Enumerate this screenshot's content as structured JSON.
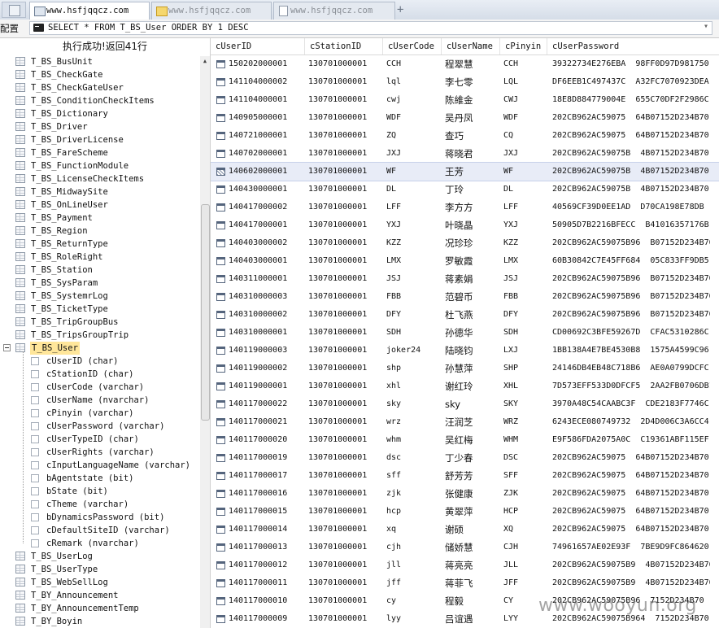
{
  "tabs": [
    {
      "label": "www.hsfjqqcz.com",
      "icon": "window-icon",
      "active": true
    },
    {
      "label": "www.hsfjqqcz.com",
      "icon": "folder-icon",
      "active": false
    },
    {
      "label": "www.hsfjqqcz.com",
      "icon": "page-icon",
      "active": false
    }
  ],
  "new_tab_label": "+",
  "query_bar": {
    "config_label": "配置",
    "sql": "SELECT * FROM T_BS_User ORDER BY 1 DESC"
  },
  "status_text": "执行成功!返回41行",
  "tree": {
    "tables_top": [
      "T_BS_BusUnit",
      "T_BS_CheckGate",
      "T_BS_CheckGateUser",
      "T_BS_ConditionCheckItems",
      "T_BS_Dictionary",
      "T_BS_Driver",
      "T_BS_DriverLicense",
      "T_BS_FareScheme",
      "T_BS_FunctionModule",
      "T_BS_LicenseCheckItems",
      "T_BS_MidwaySite",
      "T_BS_OnLineUser",
      "T_BS_Payment",
      "T_BS_Region",
      "T_BS_ReturnType",
      "T_BS_RoleRight",
      "T_BS_Station",
      "T_BS_SysParam",
      "T_BS_SystemrLog",
      "T_BS_TicketType",
      "T_BS_TripGroupBus",
      "T_BS_TripsGroupTrip"
    ],
    "selected_table": "T_BS_User",
    "columns": [
      "cUserID (char)",
      "cStationID (char)",
      "cUserCode (varchar)",
      "cUserName (nvarchar)",
      "cPinyin (varchar)",
      "cUserPassword (varchar)",
      "cUserTypeID (char)",
      "cUserRights (varchar)",
      "cInputLanguageName (varchar)",
      "bAgentstate (bit)",
      "bState (bit)",
      "cTheme (varchar)",
      "bDynamicsPassword (bit)",
      "cDefaultSiteID (varchar)",
      "cRemark (nvarchar)"
    ],
    "tables_bottom": [
      "T_BS_UserLog",
      "T_BS_UserType",
      "T_BS_WebSellLog",
      "T_BY_Announcement",
      "T_BY_AnnouncementTemp",
      "T_BY_Boyin"
    ]
  },
  "grid": {
    "headers": [
      "cUserID",
      "cStationID",
      "cUserCode",
      "cUserName",
      "cPinyin",
      "cUserPassword"
    ],
    "selected_row": 6,
    "rows": [
      [
        "150202000001",
        "130701000001",
        "CCH",
        "程翠慧",
        "CCH",
        "39322734E276EBA  98FF0D97D981750"
      ],
      [
        "141104000002",
        "130701000001",
        "lql",
        "李七零",
        "LQL",
        "DF6EEB1C497437C  A32FC7070923DEA"
      ],
      [
        "141104000001",
        "130701000001",
        "cwj",
        "陈維金",
        "CWJ",
        "18E8D884779004E  655C70DF2F2986C"
      ],
      [
        "140905000001",
        "130701000001",
        "WDF",
        "吴丹凤",
        "WDF",
        "202CB962AC59075  64B07152D234B70"
      ],
      [
        "140721000001",
        "130701000001",
        "ZQ",
        "查巧",
        "CQ",
        "202CB962AC59075  64B07152D234B70"
      ],
      [
        "140702000001",
        "130701000001",
        "JXJ",
        "蒋晓君",
        "JXJ",
        "202CB962AC59075B  4B07152D234B70"
      ],
      [
        "140602000001",
        "130701000001",
        "WF",
        "王芳",
        "WF",
        "202CB962AC59075B  4B07152D234B70"
      ],
      [
        "140430000001",
        "130701000001",
        "DL",
        "丁玲",
        "DL",
        "202CB962AC59075B  4B07152D234B70"
      ],
      [
        "140417000002",
        "130701000001",
        "LFF",
        "李方方",
        "LFF",
        "40569CF39D0EE1AD  D70CA198E78DB"
      ],
      [
        "140417000001",
        "130701000001",
        "YXJ",
        "叶晓晶",
        "YXJ",
        "50905D7B2216BFECC  B41016357176B"
      ],
      [
        "140403000002",
        "130701000001",
        "KZZ",
        "况珍珍",
        "KZZ",
        "202CB962AC59075B96  B07152D234B70"
      ],
      [
        "140403000001",
        "130701000001",
        "LMX",
        "罗敏霞",
        "LMX",
        "60B30842C7E45FF684  05C833FF9DB5"
      ],
      [
        "140311000001",
        "130701000001",
        "JSJ",
        "蒋素娟",
        "JSJ",
        "202CB962AC59075B96  B07152D234B70"
      ],
      [
        "140310000003",
        "130701000001",
        "FBB",
        "范碧币",
        "FBB",
        "202CB962AC59075B96  B07152D234B70"
      ],
      [
        "140310000002",
        "130701000001",
        "DFY",
        "杜飞燕",
        "DFY",
        "202CB962AC59075B96  B07152D234B70"
      ],
      [
        "140310000001",
        "130701000001",
        "SDH",
        "孙德华",
        "SDH",
        "CD00692C3BFE59267D  CFAC5310286C"
      ],
      [
        "140119000003",
        "130701000001",
        "joker24",
        "陆晓钧",
        "LXJ",
        "1BB138A4E7BE4530B8  1575A4599C96"
      ],
      [
        "140119000002",
        "130701000001",
        "shp",
        "孙慧萍",
        "SHP",
        "24146DB4EB48C718B6  AE0A0799DCFC"
      ],
      [
        "140119000001",
        "130701000001",
        "xhl",
        "谢红玲",
        "XHL",
        "7D573EFF533D0DFCF5  2AA2FB0706DB1"
      ],
      [
        "140117000022",
        "130701000001",
        "sky",
        "sky",
        "SKY",
        "3970A48C54CAABC3F  CDE2183F7746C"
      ],
      [
        "140117000021",
        "130701000001",
        "wrz",
        "汪润芝",
        "WRZ",
        "6243ECE080749732  2D4D006C3A6CC4"
      ],
      [
        "140117000020",
        "130701000001",
        "whm",
        "吴红梅",
        "WHM",
        "E9F586FDA2075A0C  C19361ABF115EF"
      ],
      [
        "140117000019",
        "130701000001",
        "dsc",
        "丁少春",
        "DSC",
        "202CB962AC59075  64B07152D234B70"
      ],
      [
        "140117000017",
        "130701000001",
        "sff",
        "舒芳芳",
        "SFF",
        "202CB962AC59075  64B07152D234B70"
      ],
      [
        "140117000016",
        "130701000001",
        "zjk",
        "张健康",
        "ZJK",
        "202CB962AC59075  64B07152D234B70"
      ],
      [
        "140117000015",
        "130701000001",
        "hcp",
        "黄翠萍",
        "HCP",
        "202CB962AC59075  64B07152D234B70"
      ],
      [
        "140117000014",
        "130701000001",
        "xq",
        "谢硕",
        "XQ",
        "202CB962AC59075  64B07152D234B70"
      ],
      [
        "140117000013",
        "130701000001",
        "cjh",
        "储娇慧",
        "CJH",
        "74961657AE02E93F  7BE9D9FC864620"
      ],
      [
        "140117000012",
        "130701000001",
        "jll",
        "蒋亮亮",
        "JLL",
        "202CB962AC59075B9  4B07152D234B70"
      ],
      [
        "140117000011",
        "130701000001",
        "jff",
        "蒋菲飞",
        "JFF",
        "202CB962AC59075B9  4B07152D234B70"
      ],
      [
        "140117000010",
        "130701000001",
        "cy",
        "程毅",
        "CY",
        "202CB962AC59075B96  7152D234B70"
      ],
      [
        "140117000009",
        "130701000001",
        "lyy",
        "吕谊遇",
        "LYY",
        "202CB962AC59075B964  7152D234B70"
      ]
    ]
  },
  "watermark": "www.wooyun.org"
}
